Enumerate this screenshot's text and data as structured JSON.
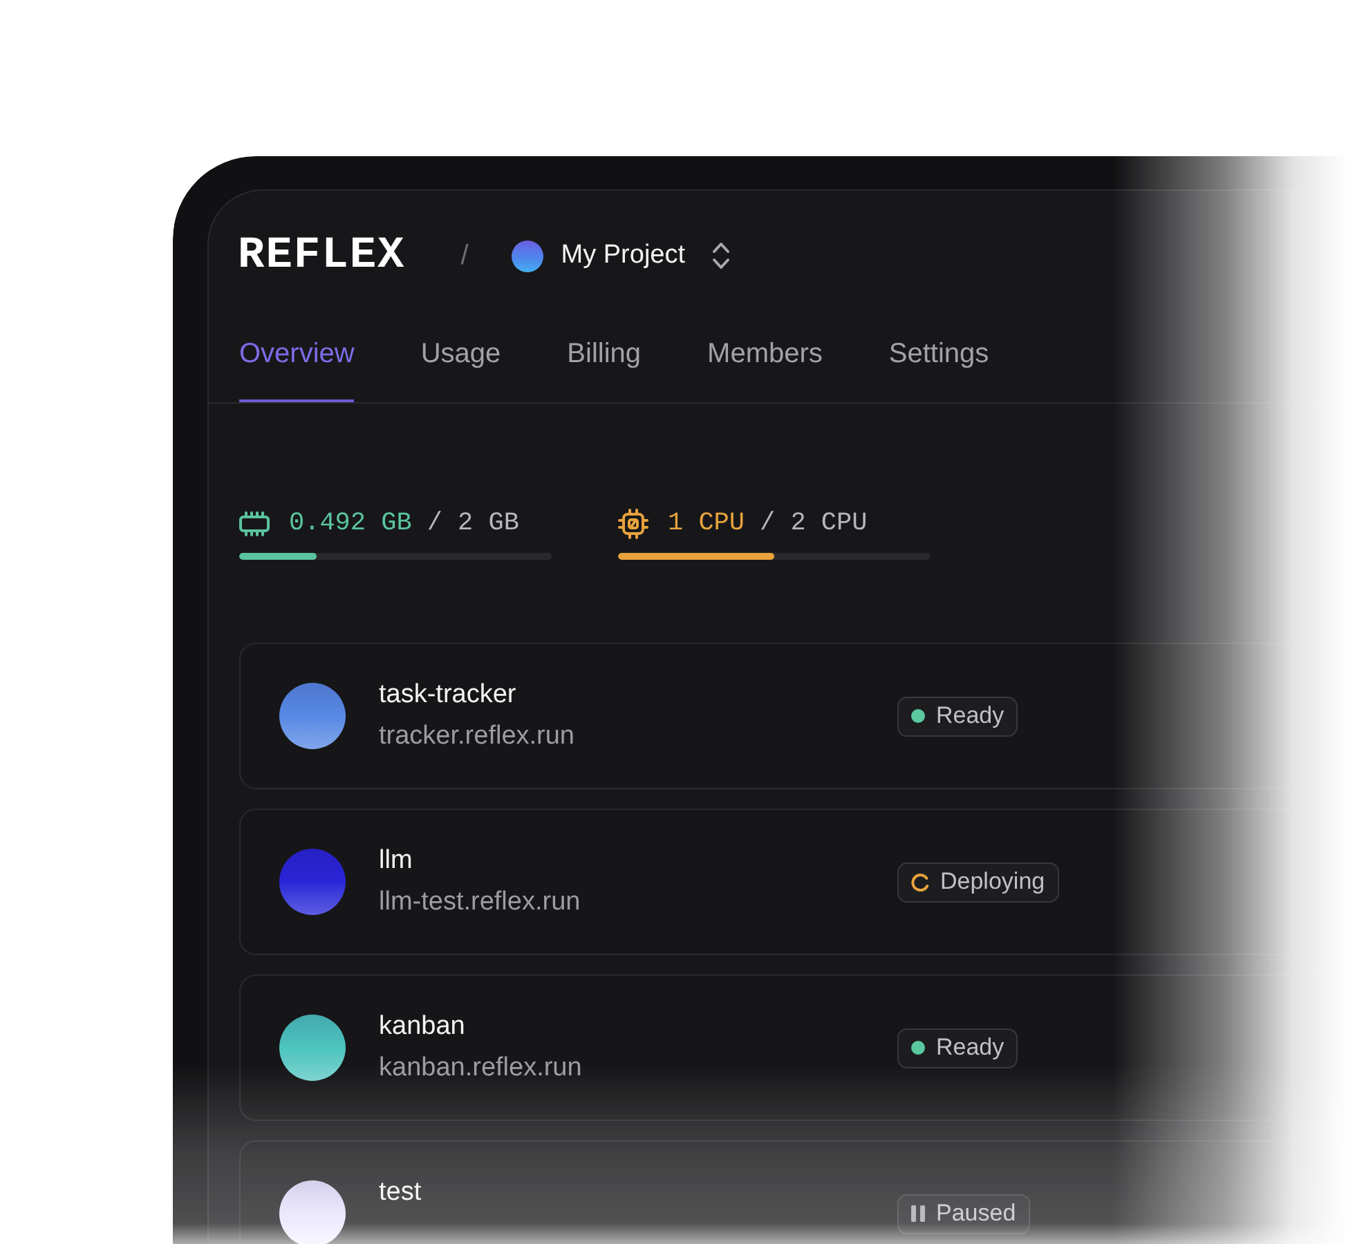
{
  "header": {
    "logo": "REFLEX",
    "separator": "/",
    "project": "My Project"
  },
  "tabs": [
    {
      "label": "Overview",
      "selected": true
    },
    {
      "label": "Usage",
      "selected": false
    },
    {
      "label": "Billing",
      "selected": false
    },
    {
      "label": "Members",
      "selected": false
    },
    {
      "label": "Settings",
      "selected": false
    }
  ],
  "resources": [
    {
      "kind": "memory",
      "used": "0.492 GB",
      "total": "/ 2 GB",
      "level": 0.246,
      "color": "#5ac4a0"
    },
    {
      "kind": "cpu",
      "used": "1 CPU",
      "total": "/ 2 CPU",
      "level": 0.5,
      "color": "#e8a33c"
    }
  ],
  "apps": [
    {
      "name": "task-tracker",
      "url": "tracker.reflex.run",
      "color": "#5789e4",
      "status": {
        "kind": "ready",
        "label": "Ready"
      }
    },
    {
      "name": "llm",
      "url": "llm-test.reflex.run",
      "color": "#2a24d8",
      "status": {
        "kind": "deploying",
        "label": "Deploying"
      }
    },
    {
      "name": "kanban",
      "url": "kanban.reflex.run",
      "color": "#4cc4be",
      "status": {
        "kind": "ready",
        "label": "Ready"
      }
    },
    {
      "name": "test",
      "color": "#e6e2ff",
      "status": {
        "kind": "paused",
        "label": "Paused"
      }
    }
  ]
}
